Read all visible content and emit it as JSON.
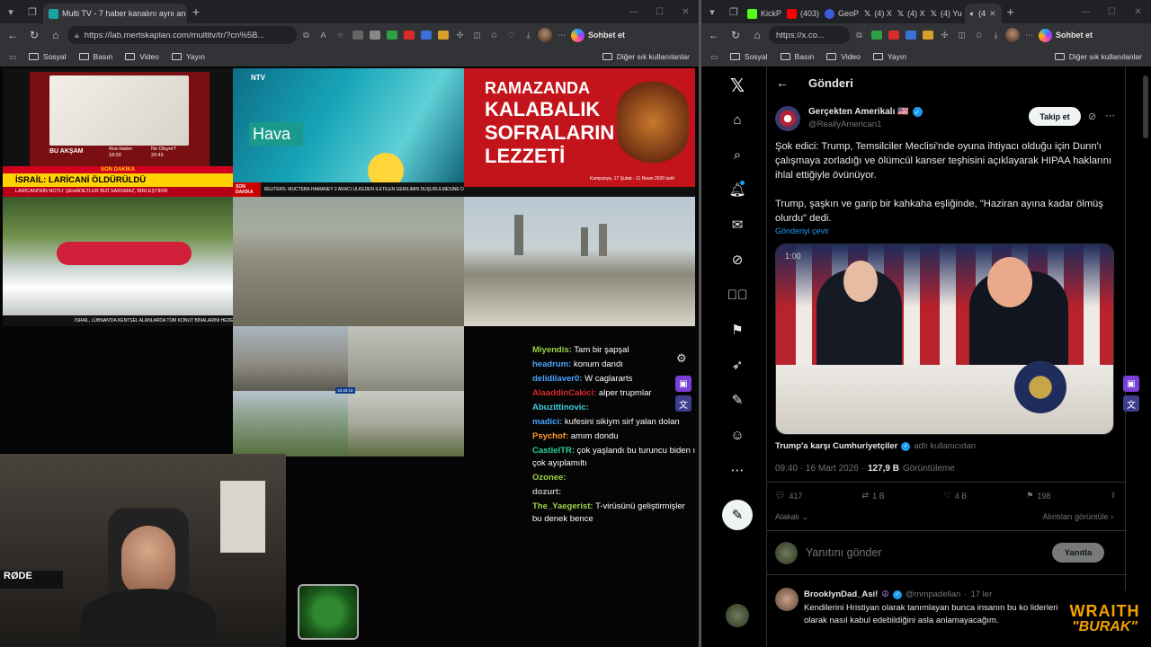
{
  "left_window": {
    "tabs": [
      {
        "label": "Multi TV - 7 haber kanalını aynı an",
        "active": true
      }
    ],
    "address": "https://lab.mertskaplan.com/multitv/tr/?cn%5B...",
    "copilot_label": "Sohbet et",
    "bookmarks": [
      "Sosyal",
      "Basın",
      "Video",
      "Yayın"
    ],
    "bookmarks_other": "Diğer sık kullanılanlar",
    "tiles": {
      "t1_headline": "İSRAİL: LARİCANİ ÖLDÜRÜLDÜ",
      "t1_tag": "SON DAKİKA",
      "t1_sub": "LARİCANİ'NİN NOTU: ŞEHADETLER BİZİ SARSMAZ, BİRLEŞTİRİR",
      "t1_bu_aksam": "BU AKŞAM",
      "t1_prog1": "Ana Haber 18:00",
      "t1_prog2": "Ne Oluyor? 20:45",
      "t2_label": "Hava",
      "t2_brand": "NTV",
      "t2_ticker": "REUTERS: MÜCTEBA HAMANEY 2 ARACI ÜLKEDEN İLETİLEN GERİLİMİN DÜŞÜRÜLMESİNE DAİR TEKLİFLERİ REDDETTİ",
      "t2_tag": "SON DAKİKA",
      "t3_line1": "RAMAZANDA",
      "t3_line2": "KALABALIK",
      "t3_line3": "SOFRALARIN",
      "t3_line4": "LEZZETİ",
      "t3_date": "Kampanya, 17 Şubat - 11 Nisan 2026 tarih",
      "t4_ticker": "İSRAİL, LÜBNAN'DA KENTSEL ALANLARDA TÜM KONUT BİNALARINI HEDEF ALIYOR",
      "t7_clock": "16:45:18"
    },
    "chat": [
      {
        "user": "Miyendis:",
        "color": "#9bd44a",
        "text": "Tam bir şapşal"
      },
      {
        "user": "headrum:",
        "color": "#4aa3ff",
        "text": "konum dandı"
      },
      {
        "user": "delidilaver0:",
        "color": "#4aa3ff",
        "text": "W caglararts"
      },
      {
        "user": "AlaaddinCakici:",
        "color": "#d92b2b",
        "text": "alper trupmlar"
      },
      {
        "user": "Abuzittinovic:",
        "color": "#3fd0e0",
        "text": ""
      },
      {
        "user": "madici:",
        "color": "#4aa3ff",
        "text": "kufesini sikiym sirf yalan dolan"
      },
      {
        "user": "Psychof:",
        "color": "#ff9a2e",
        "text": "amım dondu"
      },
      {
        "user": "CastielTR:",
        "color": "#2bd4a0",
        "text": "çok yaşlandı bu turuncu biden ı çok ayıplamıltı"
      },
      {
        "user": "Ozonee:",
        "color": "#9bd44a",
        "text": ""
      },
      {
        "user": "dozurt:",
        "color": "#bbbbbb",
        "text": ""
      },
      {
        "user": "The_Yaegerist:",
        "color": "#9bd44a",
        "text": "T-virüsünü geliştirmişler bu denek bence"
      }
    ]
  },
  "right_window": {
    "tabs": [
      "KickP",
      "(403)",
      "GeoP",
      "(4) X",
      "(4) X",
      "(4) Yu",
      "(4"
    ],
    "address": "https://x.co...",
    "copilot_label": "Sohbet et",
    "bookmarks": [
      "Sosyal",
      "Basın",
      "Video",
      "Yayın"
    ],
    "bookmarks_other": "Diğer sık kullanılanlar",
    "header_title": "Gönderi",
    "author_name": "Gerçekten Amerikalı 🇺🇸",
    "author_handle": "@ReallyAmerican1",
    "follow_label": "Takip et",
    "tweet_p1": "Şok edici: Trump, Temsilciler Meclisi'nde oyuna ihtiyacı olduğu için Dunn'ı çalışmaya zorladığı ve ölümcül kanser teşhisini açıklayarak HIPAA haklarını ihlal ettiğiyle övünüyor.",
    "tweet_p2": "Trump, şaşkın ve garip bir kahkaha eşliğinde, \"Haziran ayına kadar ölmüş olurdu\" dedi.",
    "translate_label": "Gönderiyi çevir",
    "video_time": "1:00",
    "quote_source": "Trump'a karşı Cumhuriyetçiler",
    "quote_suffix": "adlı kullanıcıdan",
    "timestamp": "09:40 · 16 Mart 2026 ·",
    "views_count": "127,9 B",
    "views_label": "Görüntüleme",
    "replies": "417",
    "retweets": "1 B",
    "likes": "4 B",
    "bookmarks_count": "198",
    "relevant_label": "Alakalı",
    "quotes_label": "Alıntıları görüntüle",
    "reply_placeholder": "Yanıtını gönder",
    "reply_button": "Yanıtla",
    "reply_author": "BrooklynDad_Asi!",
    "reply_handle": "@mmpadellan",
    "reply_time": "17 ler",
    "reply_text": "Kendilerini Hristiyan olarak tanımlayan bunca insanın bu ko liderleri olarak nasıl kabul edebildiğini asla anlamayacağım."
  },
  "overlay": {
    "wraith_1": "WRAITH",
    "wraith_2": "\"BURAK\""
  }
}
